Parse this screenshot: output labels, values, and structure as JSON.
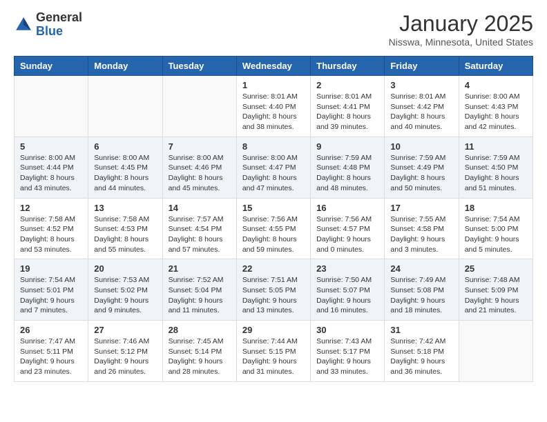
{
  "header": {
    "logo_general": "General",
    "logo_blue": "Blue",
    "month_title": "January 2025",
    "subtitle": "Nisswa, Minnesota, United States"
  },
  "days_of_week": [
    "Sunday",
    "Monday",
    "Tuesday",
    "Wednesday",
    "Thursday",
    "Friday",
    "Saturday"
  ],
  "weeks": [
    [
      {
        "day": "",
        "info": ""
      },
      {
        "day": "",
        "info": ""
      },
      {
        "day": "",
        "info": ""
      },
      {
        "day": "1",
        "info": "Sunrise: 8:01 AM\nSunset: 4:40 PM\nDaylight: 8 hours\nand 38 minutes."
      },
      {
        "day": "2",
        "info": "Sunrise: 8:01 AM\nSunset: 4:41 PM\nDaylight: 8 hours\nand 39 minutes."
      },
      {
        "day": "3",
        "info": "Sunrise: 8:01 AM\nSunset: 4:42 PM\nDaylight: 8 hours\nand 40 minutes."
      },
      {
        "day": "4",
        "info": "Sunrise: 8:00 AM\nSunset: 4:43 PM\nDaylight: 8 hours\nand 42 minutes."
      }
    ],
    [
      {
        "day": "5",
        "info": "Sunrise: 8:00 AM\nSunset: 4:44 PM\nDaylight: 8 hours\nand 43 minutes."
      },
      {
        "day": "6",
        "info": "Sunrise: 8:00 AM\nSunset: 4:45 PM\nDaylight: 8 hours\nand 44 minutes."
      },
      {
        "day": "7",
        "info": "Sunrise: 8:00 AM\nSunset: 4:46 PM\nDaylight: 8 hours\nand 45 minutes."
      },
      {
        "day": "8",
        "info": "Sunrise: 8:00 AM\nSunset: 4:47 PM\nDaylight: 8 hours\nand 47 minutes."
      },
      {
        "day": "9",
        "info": "Sunrise: 7:59 AM\nSunset: 4:48 PM\nDaylight: 8 hours\nand 48 minutes."
      },
      {
        "day": "10",
        "info": "Sunrise: 7:59 AM\nSunset: 4:49 PM\nDaylight: 8 hours\nand 50 minutes."
      },
      {
        "day": "11",
        "info": "Sunrise: 7:59 AM\nSunset: 4:50 PM\nDaylight: 8 hours\nand 51 minutes."
      }
    ],
    [
      {
        "day": "12",
        "info": "Sunrise: 7:58 AM\nSunset: 4:52 PM\nDaylight: 8 hours\nand 53 minutes."
      },
      {
        "day": "13",
        "info": "Sunrise: 7:58 AM\nSunset: 4:53 PM\nDaylight: 8 hours\nand 55 minutes."
      },
      {
        "day": "14",
        "info": "Sunrise: 7:57 AM\nSunset: 4:54 PM\nDaylight: 8 hours\nand 57 minutes."
      },
      {
        "day": "15",
        "info": "Sunrise: 7:56 AM\nSunset: 4:55 PM\nDaylight: 8 hours\nand 59 minutes."
      },
      {
        "day": "16",
        "info": "Sunrise: 7:56 AM\nSunset: 4:57 PM\nDaylight: 9 hours\nand 0 minutes."
      },
      {
        "day": "17",
        "info": "Sunrise: 7:55 AM\nSunset: 4:58 PM\nDaylight: 9 hours\nand 3 minutes."
      },
      {
        "day": "18",
        "info": "Sunrise: 7:54 AM\nSunset: 5:00 PM\nDaylight: 9 hours\nand 5 minutes."
      }
    ],
    [
      {
        "day": "19",
        "info": "Sunrise: 7:54 AM\nSunset: 5:01 PM\nDaylight: 9 hours\nand 7 minutes."
      },
      {
        "day": "20",
        "info": "Sunrise: 7:53 AM\nSunset: 5:02 PM\nDaylight: 9 hours\nand 9 minutes."
      },
      {
        "day": "21",
        "info": "Sunrise: 7:52 AM\nSunset: 5:04 PM\nDaylight: 9 hours\nand 11 minutes."
      },
      {
        "day": "22",
        "info": "Sunrise: 7:51 AM\nSunset: 5:05 PM\nDaylight: 9 hours\nand 13 minutes."
      },
      {
        "day": "23",
        "info": "Sunrise: 7:50 AM\nSunset: 5:07 PM\nDaylight: 9 hours\nand 16 minutes."
      },
      {
        "day": "24",
        "info": "Sunrise: 7:49 AM\nSunset: 5:08 PM\nDaylight: 9 hours\nand 18 minutes."
      },
      {
        "day": "25",
        "info": "Sunrise: 7:48 AM\nSunset: 5:09 PM\nDaylight: 9 hours\nand 21 minutes."
      }
    ],
    [
      {
        "day": "26",
        "info": "Sunrise: 7:47 AM\nSunset: 5:11 PM\nDaylight: 9 hours\nand 23 minutes."
      },
      {
        "day": "27",
        "info": "Sunrise: 7:46 AM\nSunset: 5:12 PM\nDaylight: 9 hours\nand 26 minutes."
      },
      {
        "day": "28",
        "info": "Sunrise: 7:45 AM\nSunset: 5:14 PM\nDaylight: 9 hours\nand 28 minutes."
      },
      {
        "day": "29",
        "info": "Sunrise: 7:44 AM\nSunset: 5:15 PM\nDaylight: 9 hours\nand 31 minutes."
      },
      {
        "day": "30",
        "info": "Sunrise: 7:43 AM\nSunset: 5:17 PM\nDaylight: 9 hours\nand 33 minutes."
      },
      {
        "day": "31",
        "info": "Sunrise: 7:42 AM\nSunset: 5:18 PM\nDaylight: 9 hours\nand 36 minutes."
      },
      {
        "day": "",
        "info": ""
      }
    ]
  ]
}
